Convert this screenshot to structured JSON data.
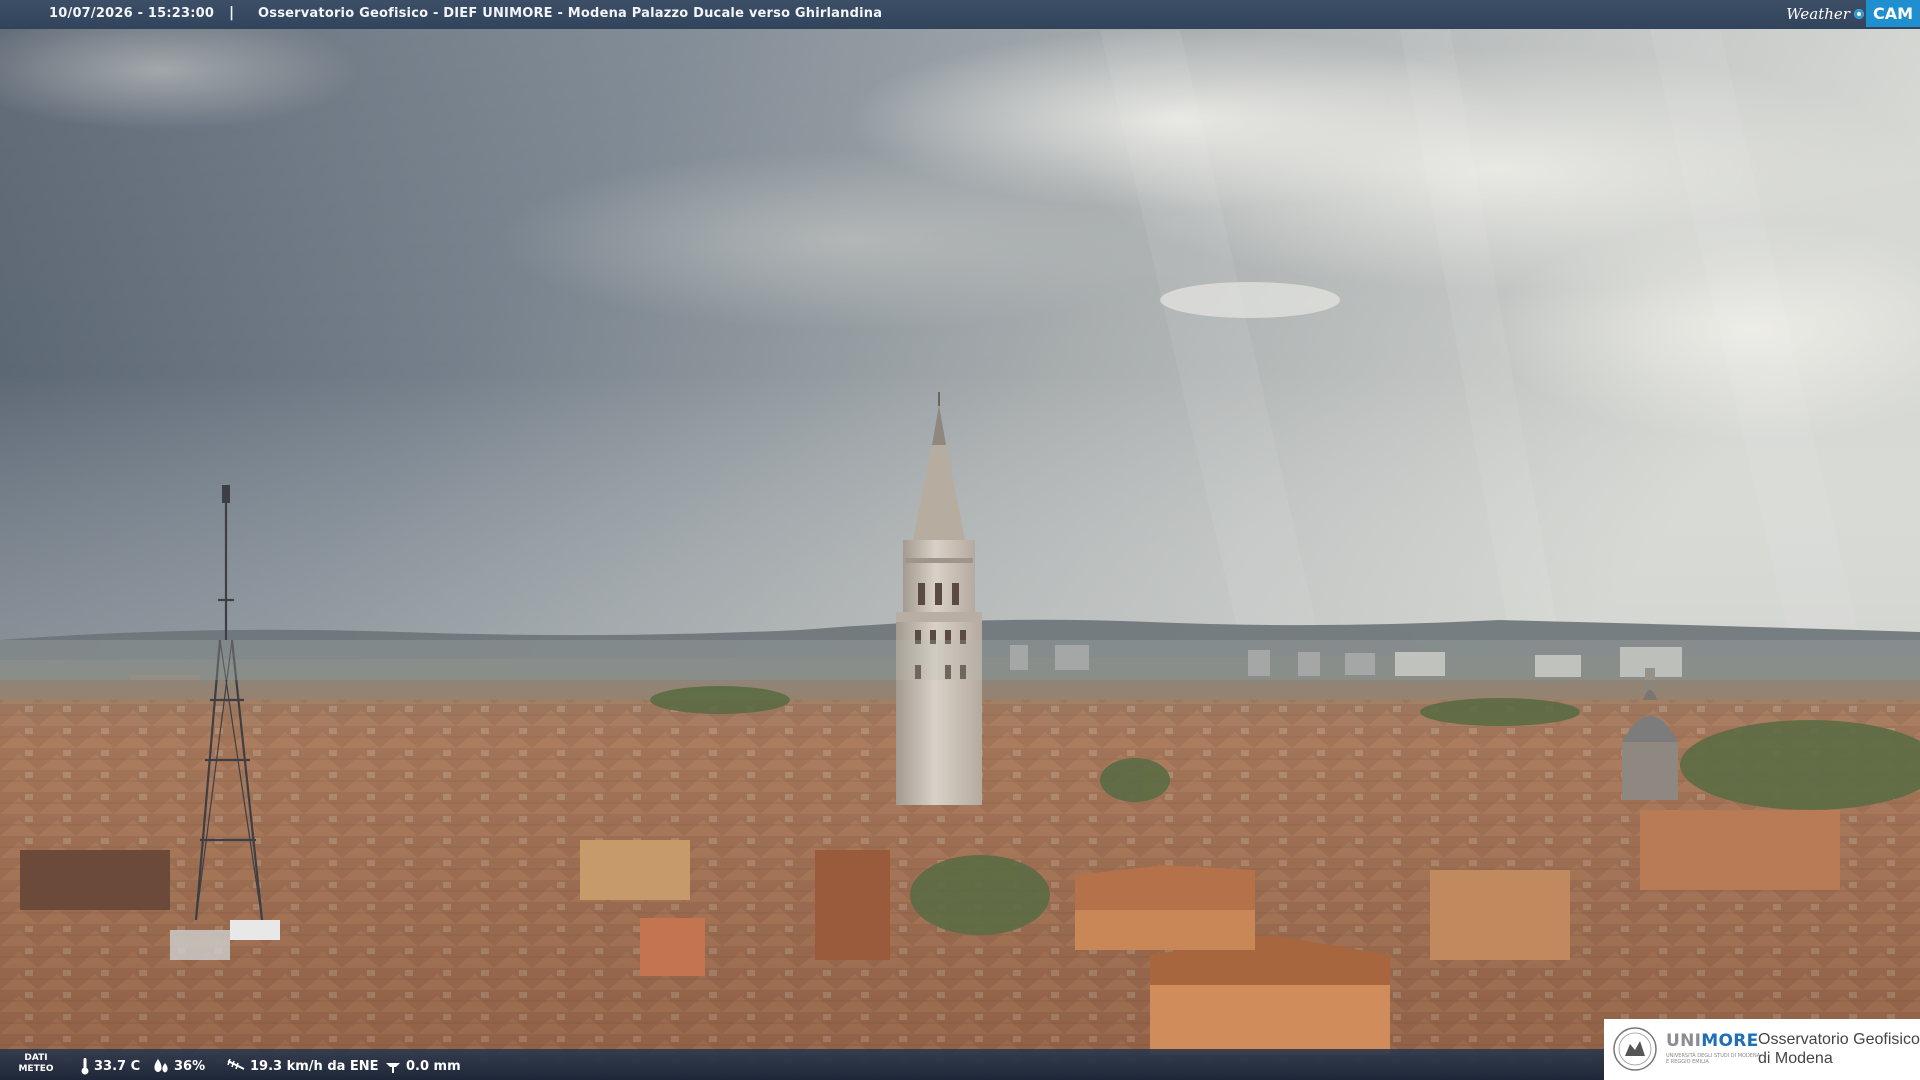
{
  "header": {
    "timestamp": "10/07/2026 - 15:23:00",
    "separator": "|",
    "camera_title": "Osservatorio Geofisico - DIEF UNIMORE - Modena Palazzo Ducale verso Ghirlandina",
    "logo_weather": "Weather",
    "logo_cam": "CAM"
  },
  "weather": {
    "label_line1": "DATI",
    "label_line2": "METEO",
    "temperature": "33.7 C",
    "humidity": "36%",
    "wind": "19.3 km/h da ENE",
    "rain": "0.0 mm"
  },
  "badge": {
    "brand_a": "UNI",
    "brand_b": "MORE",
    "brand_sub": "UNIVERSITÀ DEGLI STUDI DI MODENA E REGGIO EMILIA",
    "org_line1": "Osservatorio Geofisico",
    "org_line2": "di Modena"
  },
  "colors": {
    "sky_dark": "#4a5563",
    "sky_light": "#d8dbd8",
    "roofs": "#9a6a4e",
    "tower": "#cfc6bc",
    "bar": "#31445c",
    "accent_blue": "#1f8fd0"
  }
}
